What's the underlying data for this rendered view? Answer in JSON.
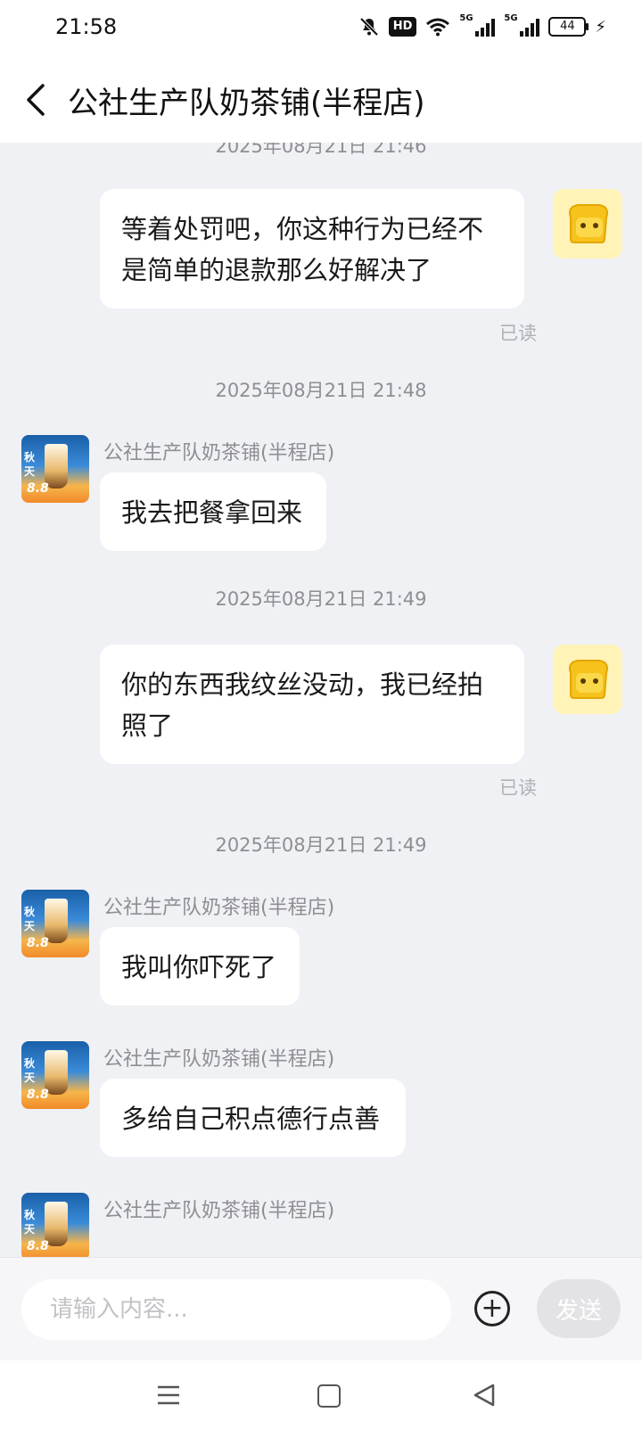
{
  "status": {
    "time": "21:58",
    "battery": "44",
    "hd": "HD",
    "net1": "5G",
    "net2": "5G"
  },
  "header": {
    "title": "公社生产队奶茶铺(半程店)"
  },
  "messages": [
    {
      "type": "timestamp",
      "text": "2025年08月21日 21:46"
    },
    {
      "type": "outgoing",
      "text": "等着处罚吧，你这种行为已经不是简单的退款那么好解决了",
      "status": "已读"
    },
    {
      "type": "timestamp",
      "text": "2025年08月21日 21:48"
    },
    {
      "type": "incoming",
      "sender": "公社生产队奶茶铺(半程店)",
      "text": "我去把餐拿回来"
    },
    {
      "type": "timestamp",
      "text": "2025年08月21日 21:49"
    },
    {
      "type": "outgoing",
      "text": "你的东西我纹丝没动，我已经拍照了",
      "status": "已读"
    },
    {
      "type": "timestamp",
      "text": "2025年08月21日 21:49"
    },
    {
      "type": "incoming",
      "sender": "公社生产队奶茶铺(半程店)",
      "text": "我叫你吓死了"
    },
    {
      "type": "incoming",
      "sender": "公社生产队奶茶铺(半程店)",
      "text": "多给自己积点德行点善"
    },
    {
      "type": "incoming",
      "sender": "公社生产队奶茶铺(半程店)",
      "text": ""
    }
  ],
  "shop_avatar": {
    "line1": "秋",
    "line2": "天",
    "price": "8.8"
  },
  "input": {
    "placeholder": "请输入内容...",
    "send_label": "发送"
  },
  "icons": [
    "bell-off-icon",
    "wifi-icon",
    "signal-icon",
    "battery-icon",
    "back-icon",
    "plus-icon",
    "menu-icon",
    "home-icon",
    "nav-back-icon"
  ]
}
